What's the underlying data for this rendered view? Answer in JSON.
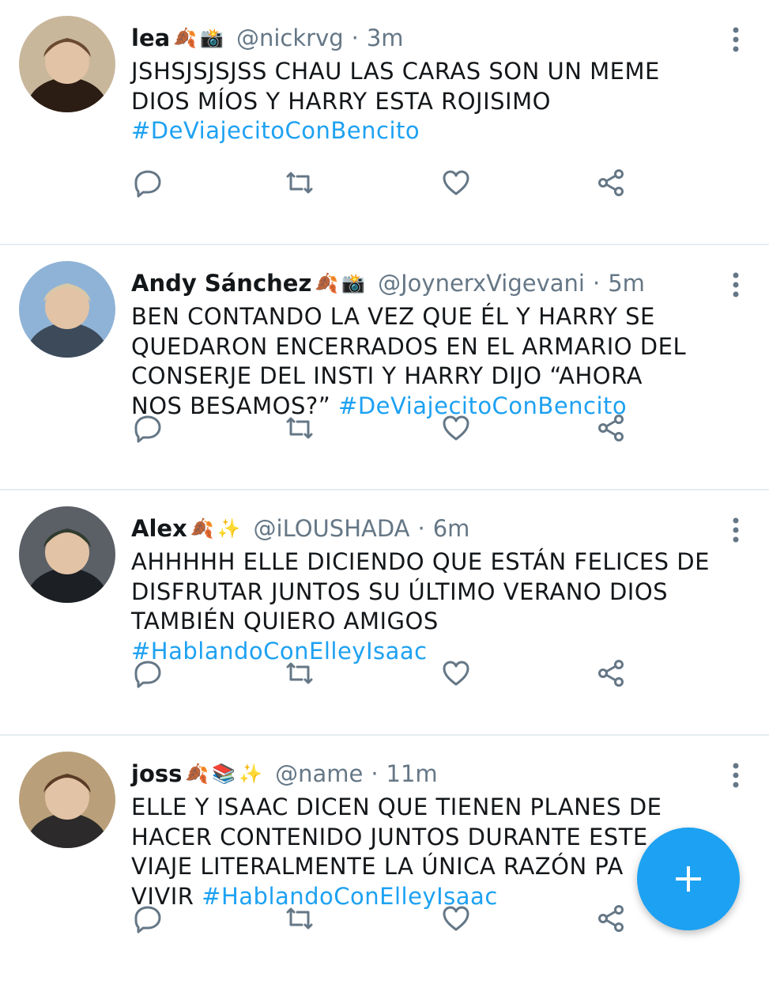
{
  "colors": {
    "accent": "#1da1f2",
    "secondary_text": "#657786",
    "primary_text": "#14171a",
    "divider": "#e6ecf0"
  },
  "tweets": [
    {
      "name": "lea",
      "emojis": [
        "🍂",
        "📸"
      ],
      "handle": "@nickrvg",
      "time": "3m",
      "text_lines": [
        "JSHSJSJSJSS CHAU LAS CARAS SON UN MEME",
        "DIOS MÍOS Y HARRY ESTA ROJISIMO"
      ],
      "last_line_prefix": "",
      "hashtag": "#DeViajecitoConBencito"
    },
    {
      "name": "Andy Sánchez",
      "emojis": [
        "🍂",
        "📸"
      ],
      "handle": "@JoynerxVigevani",
      "time": "5m",
      "text_lines": [
        "BEN CONTANDO LA VEZ QUE ÉL Y HARRY SE",
        "QUEDARON ENCERRADOS EN EL ARMARIO DEL",
        "CONSERJE DEL INSTI Y HARRY DIJO “AHORA"
      ],
      "last_line_prefix": "NOS BESAMOS?” ",
      "hashtag": "#DeViajecitoConBencito"
    },
    {
      "name": "Alex",
      "emojis": [
        "🍂",
        "✨"
      ],
      "handle": "@iLOUSHADA",
      "time": "6m",
      "text_lines": [
        "AHHHHH ELLE DICIENDO QUE ESTÁN FELICES DE",
        "DISFRUTAR JUNTOS SU ÚLTIMO VERANO DIOS",
        "TAMBIÉN QUIERO AMIGOS"
      ],
      "last_line_prefix": "",
      "hashtag": "#HablandoConElleyIsaac"
    },
    {
      "name": "joss",
      "emojis": [
        "🍂",
        "📚",
        "✨"
      ],
      "handle": "@name",
      "time": "11m",
      "text_lines": [
        "ELLE Y ISAAC DICEN QUE TIENEN PLANES DE",
        "HACER CONTENIDO JUNTOS DURANTE ESTE",
        "VIAJE LITERALMENTE LA ÚNICA RAZÓN PA"
      ],
      "last_line_prefix": "VIVIR ",
      "hashtag": "#HablandoConElleyIsaac"
    }
  ],
  "icons": {
    "reply": "reply-icon",
    "retweet": "retweet-icon",
    "like": "heart-icon",
    "share": "share-icon",
    "more": "more-vertical-icon",
    "compose": "plus-icon"
  }
}
